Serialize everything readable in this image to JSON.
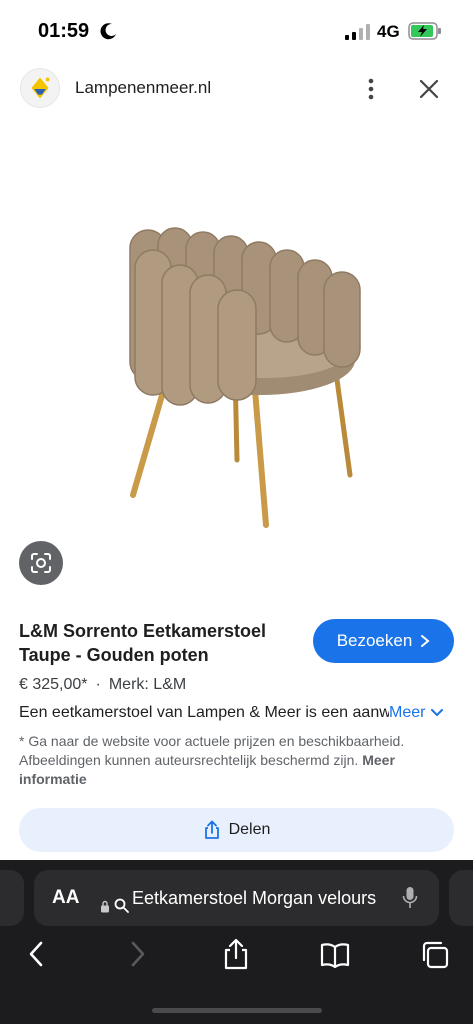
{
  "status_bar": {
    "time": "01:59",
    "network": "4G",
    "icons": [
      "moon-icon",
      "signal-icon",
      "battery-charging-icon"
    ]
  },
  "header": {
    "site_name": "Lampenenmeer.nl",
    "icons": [
      "site-logo-icon",
      "more-vertical-icon",
      "close-icon"
    ]
  },
  "product": {
    "image": "chair-image",
    "title": "L&M Sorrento Eetkamerstoel Taupe - Gouden poten",
    "visit_label": "Bezoeken",
    "price": "€ 325,00*",
    "brand": "Merk: L&M",
    "separator": "·",
    "description": "Een eetkamerstoel van Lampen & Meer is een aanwinst",
    "more_label": "Meer"
  },
  "disclaimer": {
    "text": "* Ga naar de website voor actuele prijzen en beschikbaarheid. Afbeeldingen kunnen auteursrechtelijk beschermd zijn. ",
    "link": "Meer informatie"
  },
  "share": {
    "label": "Delen"
  },
  "browser": {
    "aa_label": "AA",
    "address_text": "Eetkamerstoel Morgan velours",
    "toolbar_icons": [
      "back-icon",
      "forward-icon",
      "share-icon",
      "bookmarks-icon",
      "tabs-icon"
    ]
  },
  "colors": {
    "accent": "#1a73e8",
    "share_bg": "#e8f0fe",
    "browser_bg": "#1c1c1e"
  }
}
